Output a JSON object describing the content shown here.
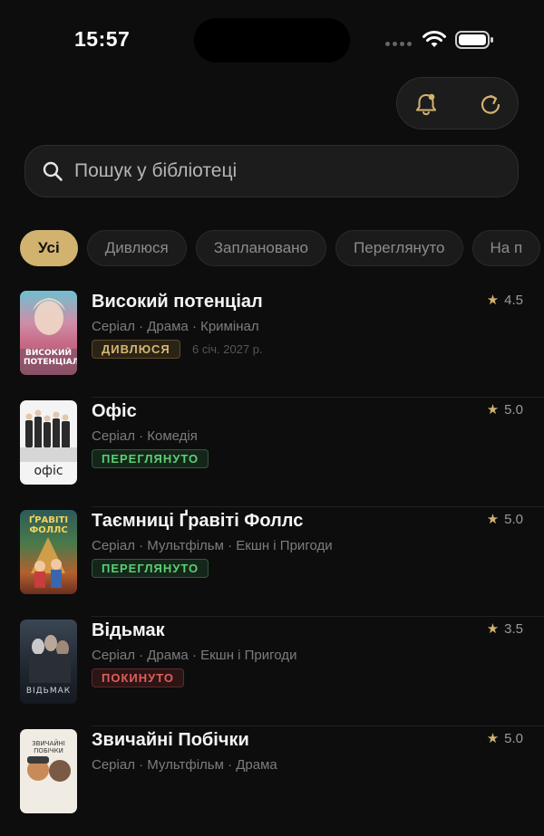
{
  "status_bar": {
    "time": "15:57"
  },
  "search": {
    "placeholder": "Пошук у бібліотеці"
  },
  "filters": [
    "Усі",
    "Дивлюся",
    "Заплановано",
    "Переглянуто",
    "На п"
  ],
  "items": [
    {
      "title": "Високий потенціал",
      "meta": "Серіал · Драма · Кримінал",
      "status": "ДИВЛЮСЯ",
      "status_type": "watching",
      "date": "6 січ. 2027 р.",
      "rating": "4.5",
      "poster_text": "ВИСОКИЙ ПОТЕНЦІАЛ"
    },
    {
      "title": "Офіс",
      "meta": "Серіал · Комедія",
      "status": "ПЕРЕГЛЯНУТО",
      "status_type": "watched",
      "rating": "5.0",
      "poster_text": "офіс"
    },
    {
      "title": "Таємниці Ґравіті Фоллс",
      "meta": "Серіал · Мультфільм · Екшн і Пригоди",
      "status": "ПЕРЕГЛЯНУТО",
      "status_type": "watched",
      "rating": "5.0",
      "poster_text": "ҐРАВІТІ ФОЛЛС"
    },
    {
      "title": "Відьмак",
      "meta": "Серіал · Драма · Екшн і Пригоди",
      "status": "ПОКИНУТО",
      "status_type": "dropped",
      "rating": "3.5",
      "poster_text": "ВІДЬМАК"
    },
    {
      "title": "Звичайні Побічки",
      "meta": "Серіал · Мультфільм · Драма",
      "rating": "5.0",
      "poster_text": "ЗВИЧАЙНІ ПОБІЧКИ"
    }
  ],
  "icons": [
    "signal-icon",
    "wifi-icon",
    "battery-icon",
    "bell-icon",
    "refresh-icon",
    "search-icon",
    "star-icon"
  ],
  "colors": {
    "accent": "#d2b26f",
    "background": "#0d0d0d",
    "watched": "#5ccf74",
    "dropped": "#e35d5d"
  }
}
